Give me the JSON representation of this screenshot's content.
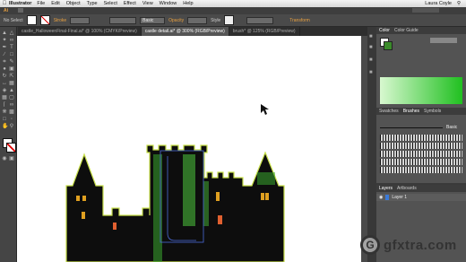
{
  "menubar": {
    "app_name": "Illustrator",
    "items": [
      "File",
      "Edit",
      "Object",
      "Type",
      "Select",
      "Effect",
      "View",
      "Window",
      "Help"
    ],
    "user_name": "Laura Coyle"
  },
  "control_bar": {
    "selection_label": "No Select",
    "stroke_label": "Stroke",
    "basic_label": "Basic",
    "opacity_label": "Opacity",
    "style_label": "Style",
    "transform_label": "Transform"
  },
  "tabs": [
    {
      "label": "castle_HalloweenFinal-Final.ai* @ 100% (CMYK/Preview)",
      "active": false
    },
    {
      "label": "castle detail.ai* @ 300% (RGB/Preview)",
      "active": true
    },
    {
      "label": "brush* @ 125% (RGB/Preview)",
      "active": false
    }
  ],
  "color_panel": {
    "tabs": [
      "Color",
      "Color Guide"
    ],
    "fill_color": "#3a8a2a",
    "gradient_colors": [
      "#c8f0c0",
      "#18c018"
    ]
  },
  "brushes_panel": {
    "tabs": [
      "Swatches",
      "Brushes",
      "Symbols"
    ],
    "active_tab": "Brushes",
    "basic_label": "Basic",
    "brush_rows": 5
  },
  "layers_panel": {
    "tabs": [
      "Layers",
      "Artboards"
    ],
    "layer_name": "Layer 1"
  },
  "watermark": {
    "text": "gfxtra.com"
  }
}
